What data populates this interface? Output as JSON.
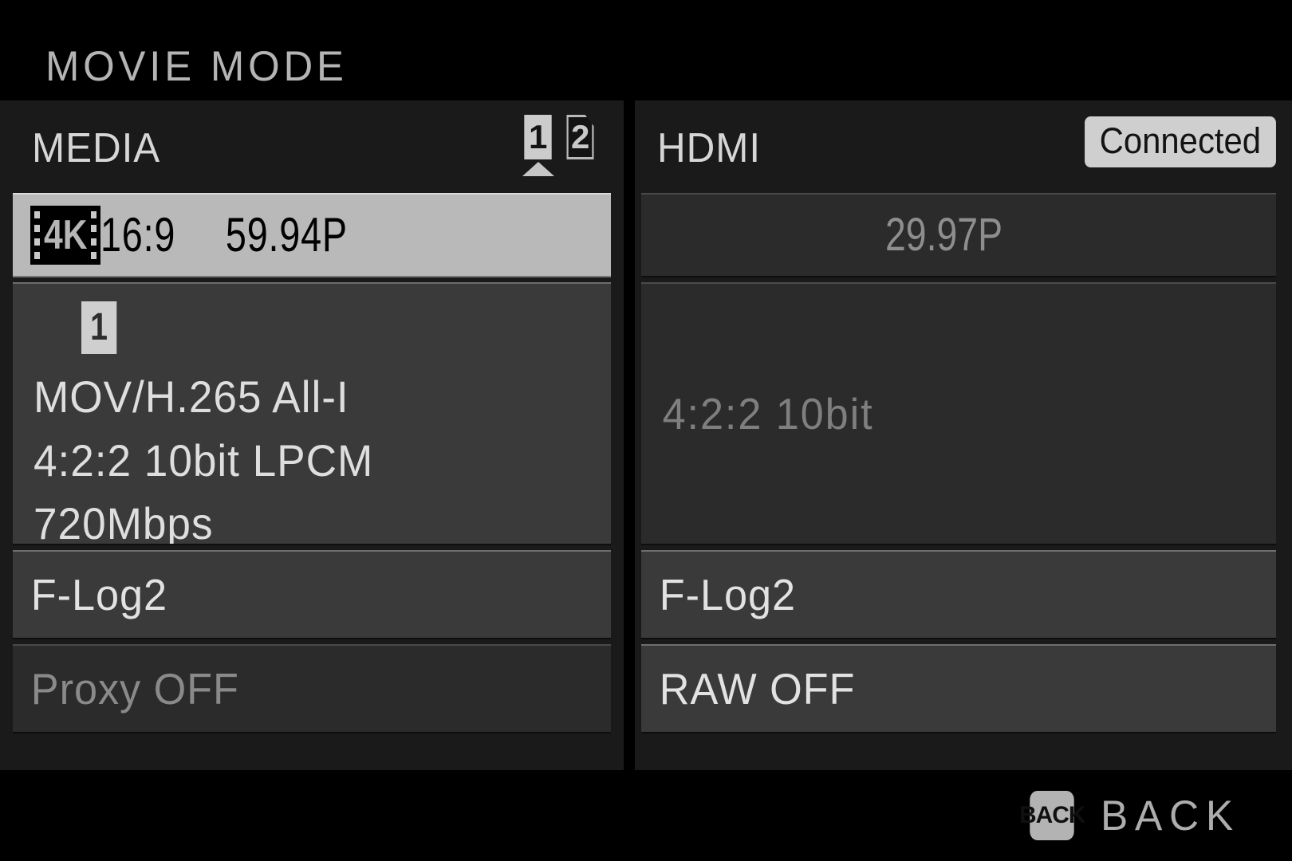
{
  "header": {
    "title": "MOVIE MODE"
  },
  "media_panel": {
    "title": "MEDIA",
    "slots": [
      {
        "label": "1",
        "state": "active",
        "icon": "card-slot-filled-icon"
      },
      {
        "label": "2",
        "state": "idle",
        "icon": "card-slot-empty-icon"
      }
    ],
    "recording_slot_caret": "recording-slot-caret-icon",
    "format_row": {
      "resolution_badge": "4K",
      "resolution_badge_icon": "film-strip-4k-icon",
      "aspect_ratio": "16:9",
      "frame_rate": "59.94P",
      "selected": true
    },
    "codec_row": {
      "slot_badge": "1",
      "lines": [
        "MOV/H.265 All-I",
        "4:2:2 10bit LPCM",
        "720Mbps"
      ]
    },
    "log_row": {
      "label": "F-Log2",
      "enabled": true
    },
    "proxy_row": {
      "label": "Proxy OFF",
      "enabled": false
    }
  },
  "hdmi_panel": {
    "title": "HDMI",
    "status_badge": "Connected",
    "fps_row": {
      "label": "29.97P",
      "enabled": false
    },
    "depth_row": {
      "label": "4:2:2 10bit",
      "enabled": false
    },
    "log_row": {
      "label": "F-Log2",
      "enabled": true
    },
    "raw_row": {
      "label": "RAW OFF",
      "enabled": true
    }
  },
  "bottom_bar": {
    "back_icon_label": "BACK",
    "back_label": "BACK"
  },
  "colors": {
    "background": "#000000",
    "panel_background": "#1a1a1a",
    "row_background": "#3a3a3a",
    "row_background_dim": "#2b2b2b",
    "row_highlight": "#b9b9b9",
    "text_primary": "#e2e2e2",
    "text_dim": "#8a8a8a",
    "badge_light": "#cfcfcf"
  }
}
